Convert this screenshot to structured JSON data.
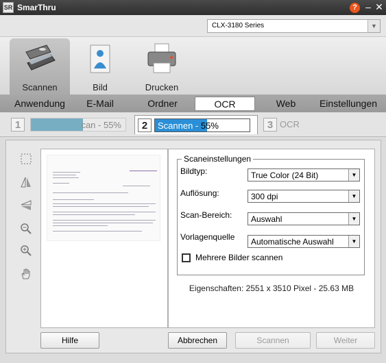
{
  "window": {
    "title": "SmarThru",
    "logo": "SR"
  },
  "device": {
    "selected": "CLX-3180 Series"
  },
  "modes": [
    {
      "label": "Scannen",
      "icon": "scanner-icon",
      "active": true
    },
    {
      "label": "Bild",
      "icon": "image-person-icon",
      "active": false
    },
    {
      "label": "Drucken",
      "icon": "printer-icon",
      "active": false
    }
  ],
  "tabs": [
    "Anwendung",
    "E-Mail",
    "Ordner",
    "OCR",
    "Web",
    "Einstellungen"
  ],
  "active_tab": "OCR",
  "steps": {
    "step1": {
      "num": "1",
      "text": "can - 55%",
      "progress": 0.55
    },
    "step2": {
      "num": "2",
      "label": "Scannen -",
      "percent": "55%",
      "progress": 0.55
    },
    "step3": {
      "num": "3",
      "label": "OCR"
    }
  },
  "settings": {
    "group_title": "Scaneinstellungen",
    "bildtyp": {
      "label": "Bildtyp:",
      "value": "True Color (24 Bit)"
    },
    "aufloesung": {
      "label": "Auflösung:",
      "value": "300 dpi"
    },
    "scanbereich": {
      "label": "Scan-Bereich:",
      "value": "Auswahl"
    },
    "vorlagenquelle": {
      "label": "Vorlagenquelle",
      "value": "Automatische Auswahl"
    },
    "multi": {
      "label": "Mehrere Bilder scannen",
      "checked": false
    },
    "properties": "Eigenschaften: 2551 x 3510 Pixel - 25.63 MB"
  },
  "buttons": {
    "hilfe": "Hilfe",
    "abbrechen": "Abbrechen",
    "scannen": "Scannen",
    "weiter": "Weiter"
  },
  "tools": [
    "select-rect-icon",
    "flip-horizontal-icon",
    "flip-vertical-icon",
    "zoom-out-icon",
    "zoom-in-icon",
    "hand-pan-icon"
  ],
  "colors": {
    "titlebar": "#3a3a3a",
    "progress_active": "#2a8fd6",
    "progress_inactive": "#78aec2",
    "help": "#e8561c"
  }
}
